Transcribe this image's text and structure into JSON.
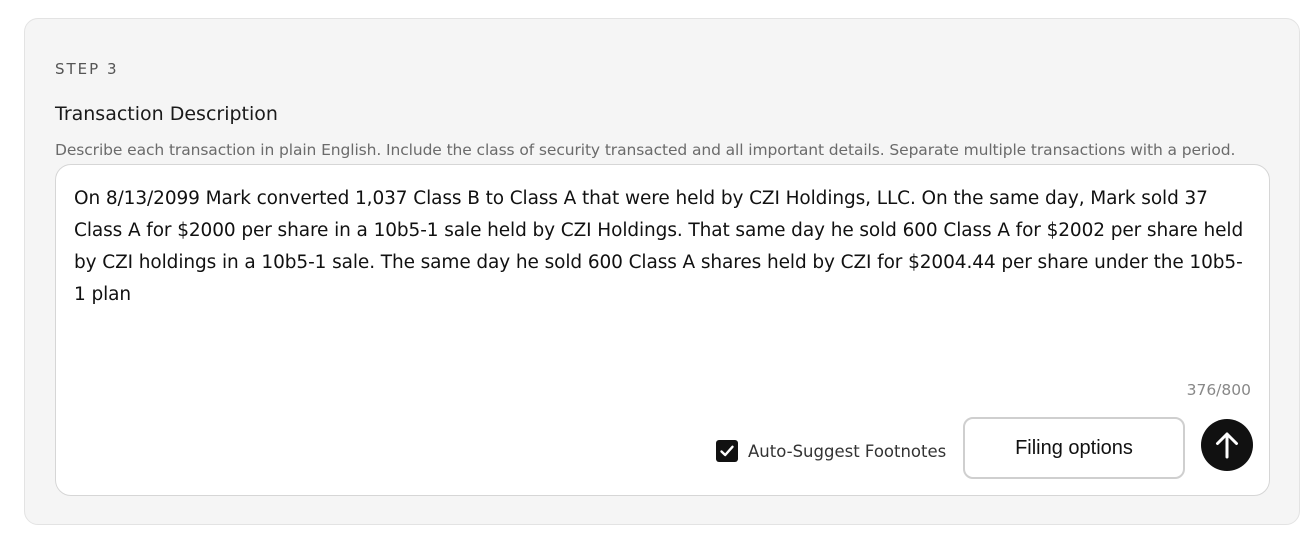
{
  "step": {
    "label": "STEP 3",
    "title": "Transaction Description",
    "helper": "Describe each transaction in plain English. Include the class of security transacted and all important details. Separate multiple transactions with a period."
  },
  "description": {
    "value": "On 8/13/2099 Mark converted 1,037 Class B to Class A that were held by CZI Holdings, LLC. On the same day, Mark sold 37 Class A for $2000 per share in a 10b5-1 sale held by CZI Holdings. That same day he sold 600 Class A for $2002 per share held by CZI holdings in a 10b5-1 sale. The same day he sold 600 Class A shares held by CZI for $2004.44 per share under the 10b5-1 plan",
    "char_count": "376/800"
  },
  "controls": {
    "auto_suggest": {
      "label": "Auto-Suggest Footnotes",
      "checked": true
    },
    "filing_options_label": "Filing options",
    "submit_icon": "arrow-up-icon"
  },
  "colors": {
    "card_background": "#f5f5f5",
    "accent_dark": "#111111"
  }
}
